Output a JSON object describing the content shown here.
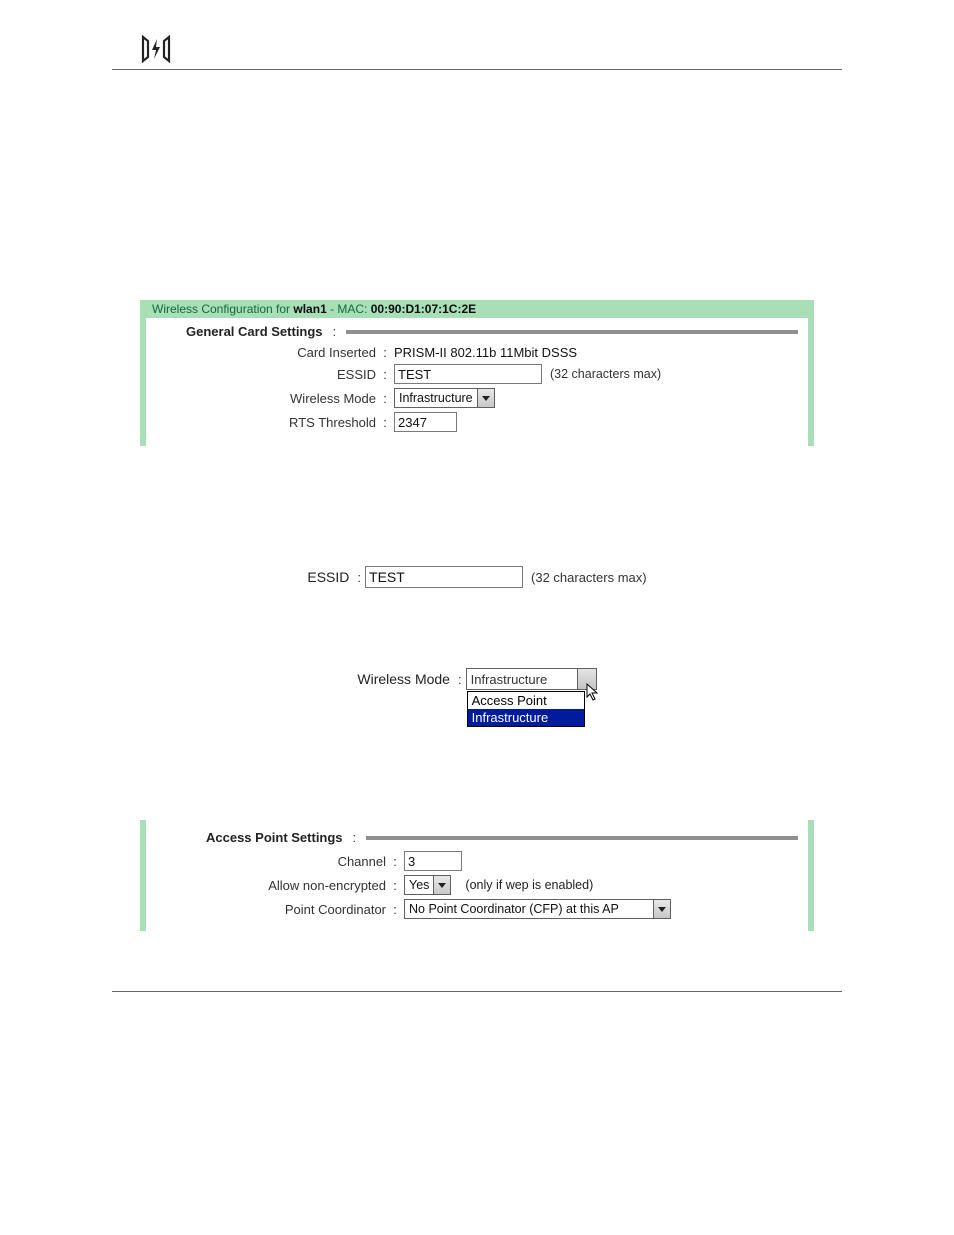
{
  "panel1": {
    "title_prefix": "Wireless Configuration for ",
    "iface": "wlan1",
    "title_mid": " - MAC: ",
    "mac": "00:90:D1:07:1C:2E",
    "group_label": "General Card Settings",
    "card_inserted_label": "Card Inserted",
    "card_inserted_value": "PRISM-II 802.11b 11Mbit DSSS",
    "essid_label": "ESSID",
    "essid_value": "TEST",
    "essid_hint": "(32 characters max)",
    "mode_label": "Wireless Mode",
    "mode_value": "Infrastructure",
    "rts_label": "RTS Threshold",
    "rts_value": "2347"
  },
  "snippet_essid": {
    "label": "ESSID",
    "value": "TEST",
    "hint": "(32 characters max)"
  },
  "snippet_mode": {
    "label": "Wireless Mode",
    "value": "Infrastructure",
    "options": [
      "Access Point",
      "Infrastructure"
    ],
    "selected_index": 1
  },
  "panel2": {
    "group_label": "Access Point Settings",
    "channel_label": "Channel",
    "channel_value": "3",
    "allow_label": "Allow non-encrypted",
    "allow_value": "Yes",
    "allow_hint": "(only if wep is enabled)",
    "pc_label": "Point Coordinator",
    "pc_value": "No Point Coordinator (CFP) at this AP"
  }
}
